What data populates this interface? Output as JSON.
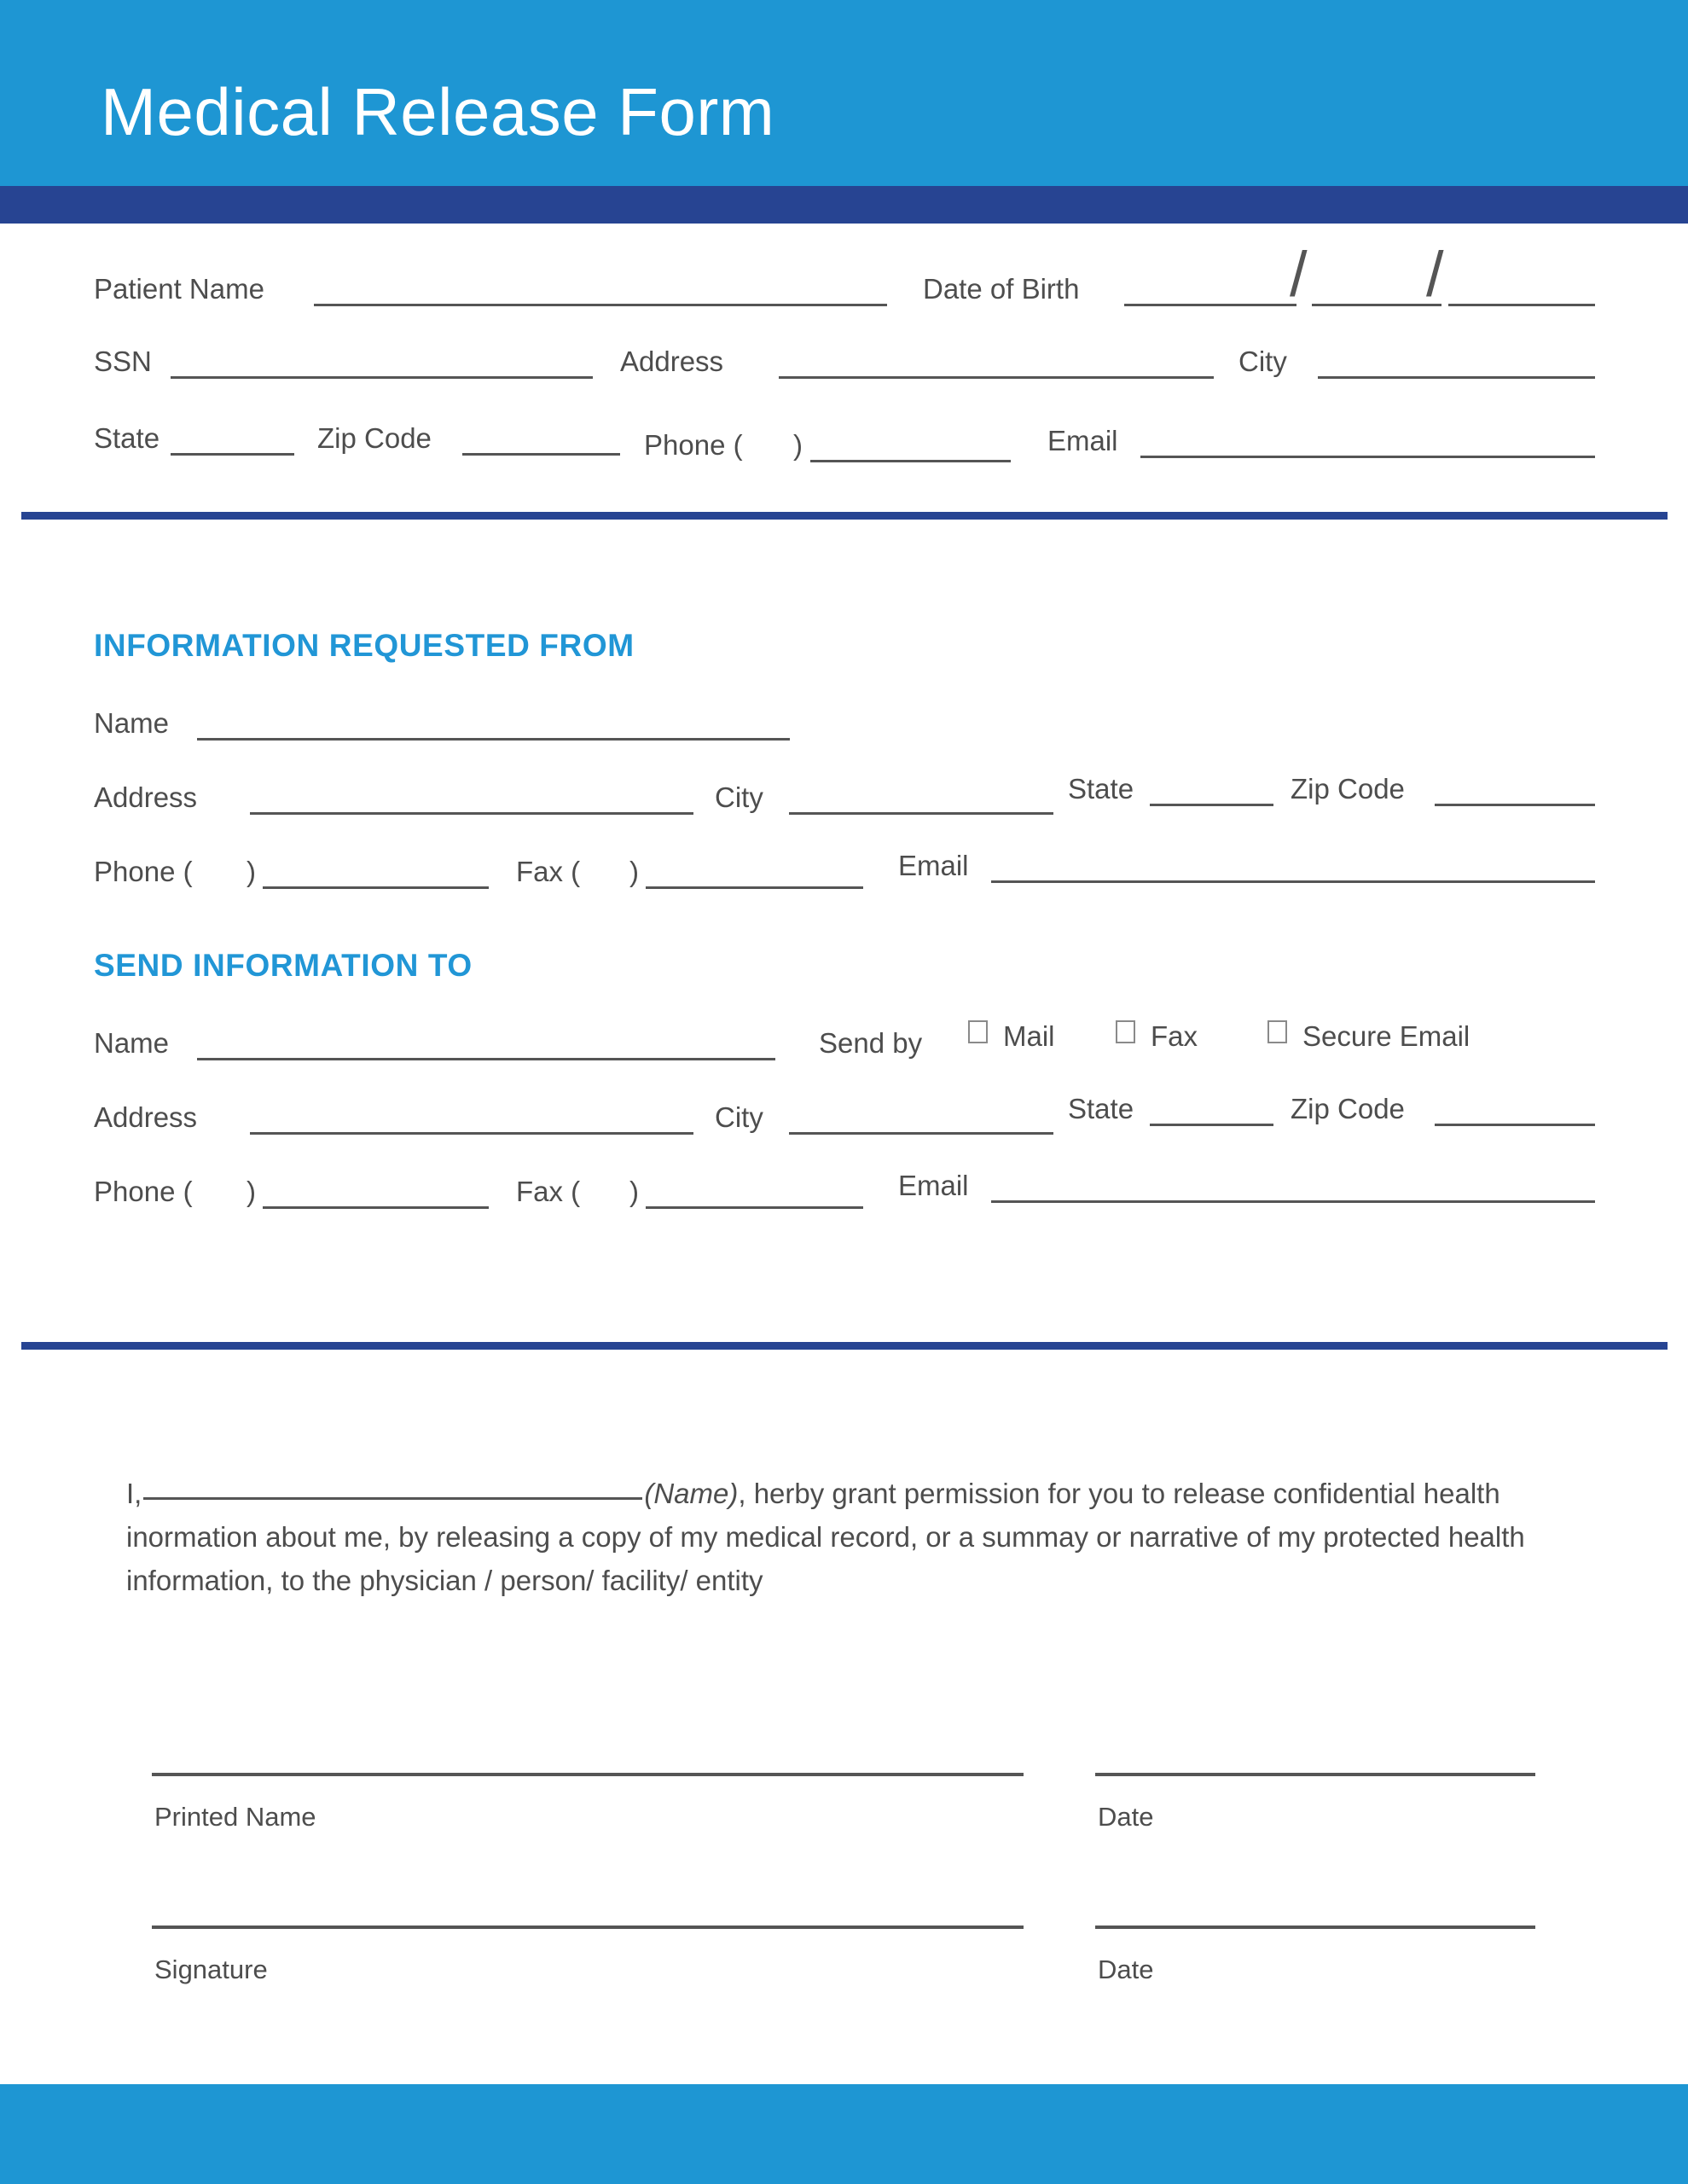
{
  "document": {
    "title": "Medical Release Form"
  },
  "colors": {
    "header_blue": "#1e96d3",
    "navy": "#274492",
    "heading_blue": "#2196d6",
    "text_gray": "#4d4d4d",
    "rule_gray": "#555555"
  },
  "patient_section": {
    "patient_name_label": "Patient Name",
    "date_of_birth_label": "Date of Birth",
    "dob_separator": "/",
    "ssn_label": "SSN",
    "address_label": "Address",
    "city_label": "City",
    "state_label": "State",
    "zip_code_label": "Zip Code",
    "phone_label": "Phone (",
    "phone_close_paren": ")",
    "email_label": "Email"
  },
  "requested_from": {
    "heading": "INFORMATION REQUESTED FROM",
    "name_label": "Name",
    "address_label": "Address",
    "city_label": "City",
    "state_label": "State",
    "zip_code_label": "Zip Code",
    "phone_label": "Phone (",
    "phone_close_paren": ")",
    "fax_label": "Fax (",
    "fax_close_paren": ")",
    "email_label": "Email"
  },
  "send_to": {
    "heading": "SEND INFORMATION TO",
    "name_label": "Name",
    "send_by_label": "Send by",
    "send_by_options": [
      "Mail",
      "Fax",
      "Secure Email"
    ],
    "address_label": "Address",
    "city_label": "City",
    "state_label": "State",
    "zip_code_label": "Zip Code",
    "phone_label": "Phone (",
    "phone_close_paren": ")",
    "fax_label": "Fax (",
    "fax_close_paren": ")",
    "email_label": "Email"
  },
  "consent": {
    "lead_in": "I,",
    "name_parenthetical": "(Name)",
    "body_after_name": ", herby grant permission for you to release confidential health inormation about me, by releasing a copy of my medical record, or a summay or narrative of my protected health information, to the physician / person/ facility/ entity"
  },
  "signature_block": {
    "printed_name_label": "Printed Name",
    "printed_name_date_label": "Date",
    "signature_label": "Signature",
    "signature_date_label": "Date"
  }
}
